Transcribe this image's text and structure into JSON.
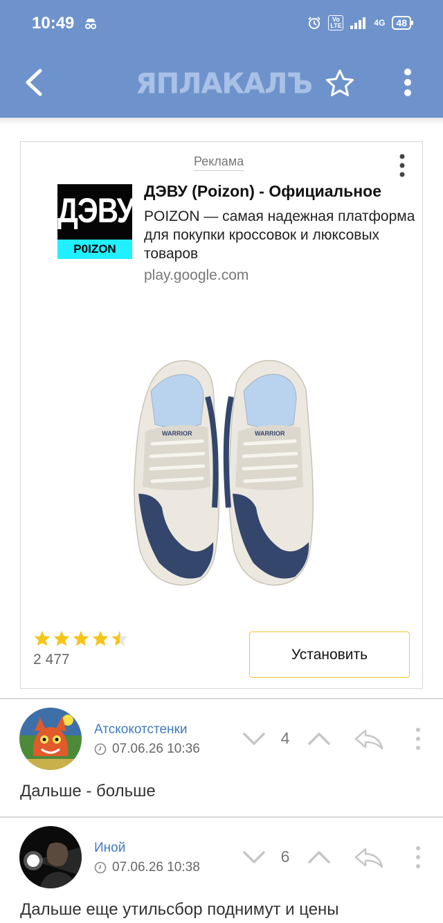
{
  "status_bar": {
    "time": "10:49",
    "network": "4G",
    "volte": "Vo LTE",
    "battery": "48"
  },
  "header": {
    "logo": "ЯПЛАКАЛЪ",
    "back_icon": "back-arrow-icon",
    "star_icon": "star-outline-icon",
    "menu_icon": "kebab-menu-icon"
  },
  "ad": {
    "label": "Реклама",
    "brand_logo_text": "ДЭВУ",
    "brand_logo_sub": "P0IZON",
    "title": "ДЭВУ (Poizon) - Официальное",
    "description": "POIZON — самая надежная платформа для покупки кроссовок и люксовых товаров",
    "url": "play.google.com",
    "rating_value": 4.5,
    "rating_count": "2 477",
    "install_label": "Установить",
    "colors": {
      "star": "#f5c518",
      "install_border": "#f1cb2c",
      "brand_strip": "#20f0ff"
    }
  },
  "comments": [
    {
      "author": "Атскокотстенки",
      "timestamp": "07.06.26 10:36",
      "score": "4",
      "text": "Дальше - больше"
    },
    {
      "author": "Иной",
      "timestamp": "07.06.26 10:38",
      "score": "6",
      "text": "Дальше еще утильсбор поднимут и цены"
    }
  ],
  "colors": {
    "header_bg": "#6e93cc",
    "author_link": "#3f7ac0"
  }
}
